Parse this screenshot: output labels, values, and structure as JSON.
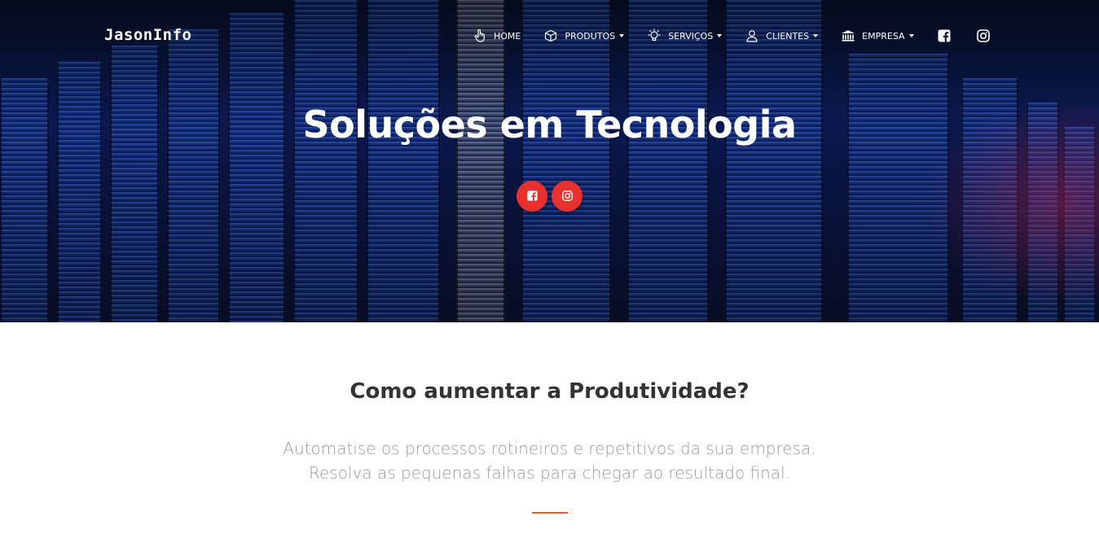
{
  "brand": {
    "logo_text": "JasonInfo"
  },
  "nav": {
    "items": [
      {
        "label": "HOME",
        "icon": "hand-pointer-icon",
        "dropdown": false
      },
      {
        "label": "PRODUTOS",
        "icon": "box-icon",
        "dropdown": true
      },
      {
        "label": "SERVIÇOS",
        "icon": "lightbulb-icon",
        "dropdown": true
      },
      {
        "label": "CLIENTES",
        "icon": "user-icon",
        "dropdown": true
      },
      {
        "label": "EMPRESA",
        "icon": "bank-icon",
        "dropdown": true
      }
    ],
    "social": [
      "facebook-icon",
      "instagram-icon"
    ]
  },
  "hero": {
    "title": "Soluções em Tecnologia",
    "social_buttons": [
      "facebook-icon",
      "instagram-icon"
    ],
    "accent_color": "#e8302f"
  },
  "main": {
    "heading": "Como aumentar a Produtividade?",
    "text_line1": "Automatise os processos rotineiros e repetitivos da sua empresa.",
    "text_line2": "Resolva as pequenas falhas para chegar ao resultado final.",
    "divider_color": "#f05a28"
  }
}
